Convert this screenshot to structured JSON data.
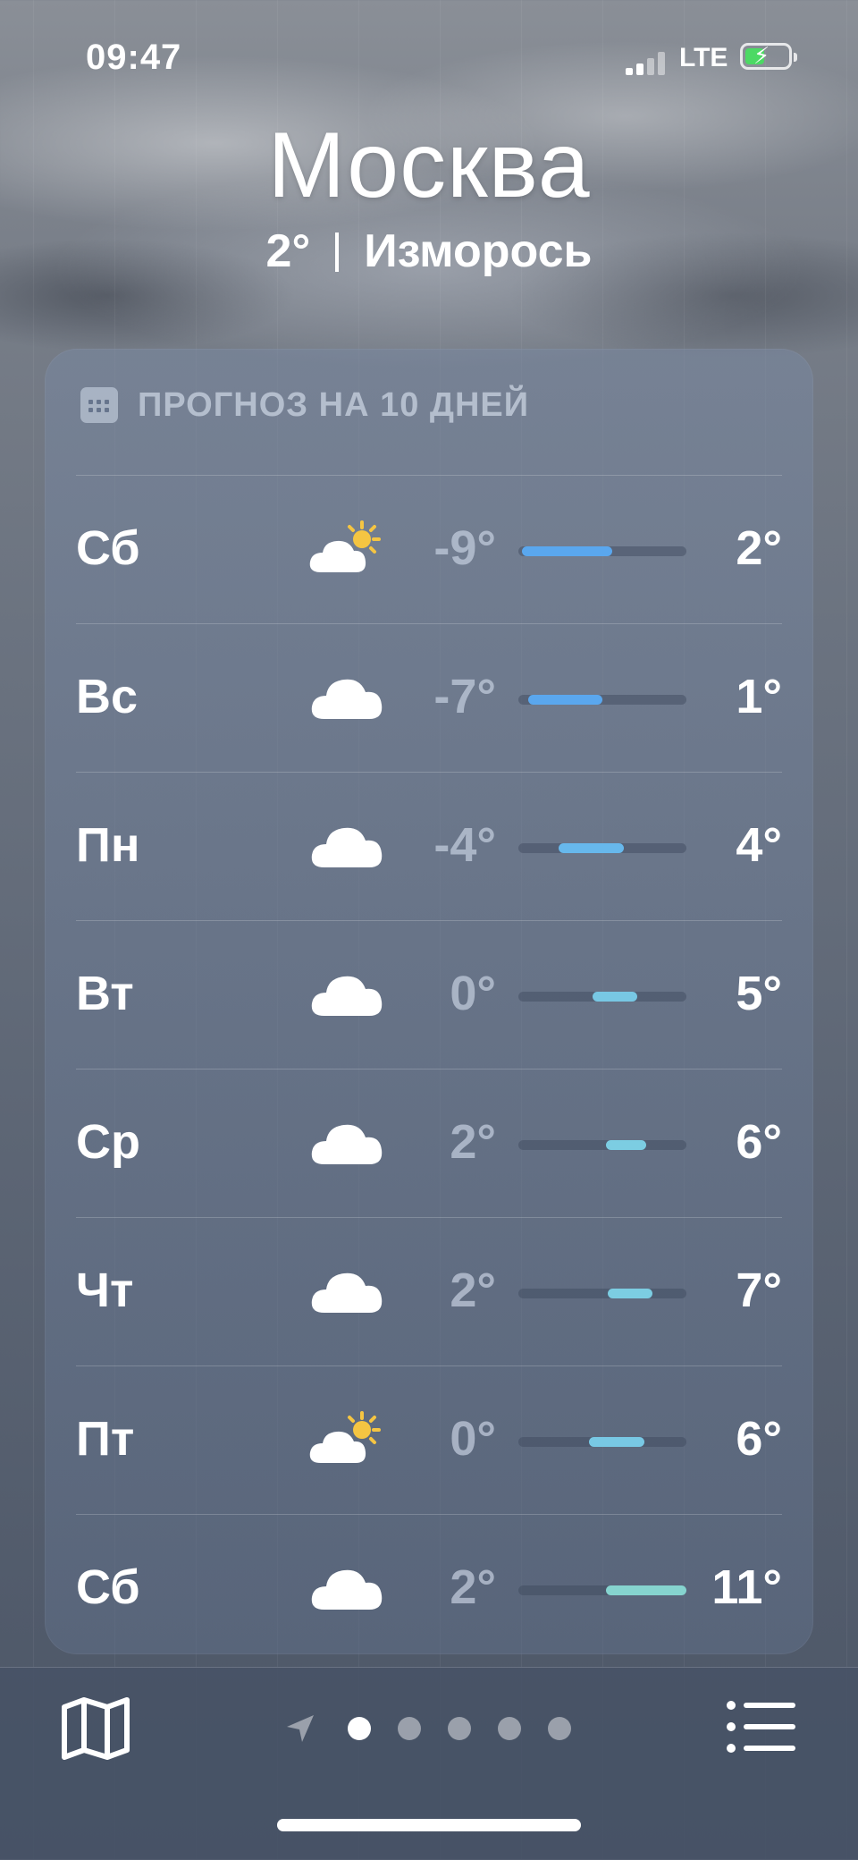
{
  "status": {
    "time": "09:47",
    "network": "LTE"
  },
  "header": {
    "city": "Москва",
    "temperature": "2°",
    "condition": "Изморось"
  },
  "forecast": {
    "title": "ПРОГНОЗ НА 10 ДНЕЙ",
    "days": [
      {
        "day": "Сб",
        "icon": "partly-sunny-icon",
        "low": "-9°",
        "high": "2°",
        "range_start": 0.02,
        "range_end": 0.56,
        "color": "#5aa7ee"
      },
      {
        "day": "Вс",
        "icon": "cloud-icon",
        "low": "-7°",
        "high": "1°",
        "range_start": 0.06,
        "range_end": 0.5,
        "color": "#5aa7ee"
      },
      {
        "day": "Пн",
        "icon": "cloud-icon",
        "low": "-4°",
        "high": "4°",
        "range_start": 0.24,
        "range_end": 0.63,
        "color": "#67b8ec"
      },
      {
        "day": "Вт",
        "icon": "cloud-icon",
        "low": "0°",
        "high": "5°",
        "range_start": 0.44,
        "range_end": 0.71,
        "color": "#78c8e4"
      },
      {
        "day": "Ср",
        "icon": "cloud-icon",
        "low": "2°",
        "high": "6°",
        "range_start": 0.52,
        "range_end": 0.76,
        "color": "#7ccde2"
      },
      {
        "day": "Чт",
        "icon": "cloud-icon",
        "low": "2°",
        "high": "7°",
        "range_start": 0.53,
        "range_end": 0.8,
        "color": "#7ccde2"
      },
      {
        "day": "Пт",
        "icon": "partly-sunny-icon",
        "low": "0°",
        "high": "6°",
        "range_start": 0.42,
        "range_end": 0.75,
        "color": "#78c8e4"
      },
      {
        "day": "Сб",
        "icon": "cloud-icon",
        "low": "2°",
        "high": "11°",
        "range_start": 0.52,
        "range_end": 1.0,
        "color": "#86d4cf"
      }
    ]
  },
  "pager": {
    "pages": 5,
    "active": 0
  },
  "colors": {
    "accent_blue": "#5aa7ee",
    "accent_teal": "#86d4cf",
    "battery": "#4cd964"
  }
}
